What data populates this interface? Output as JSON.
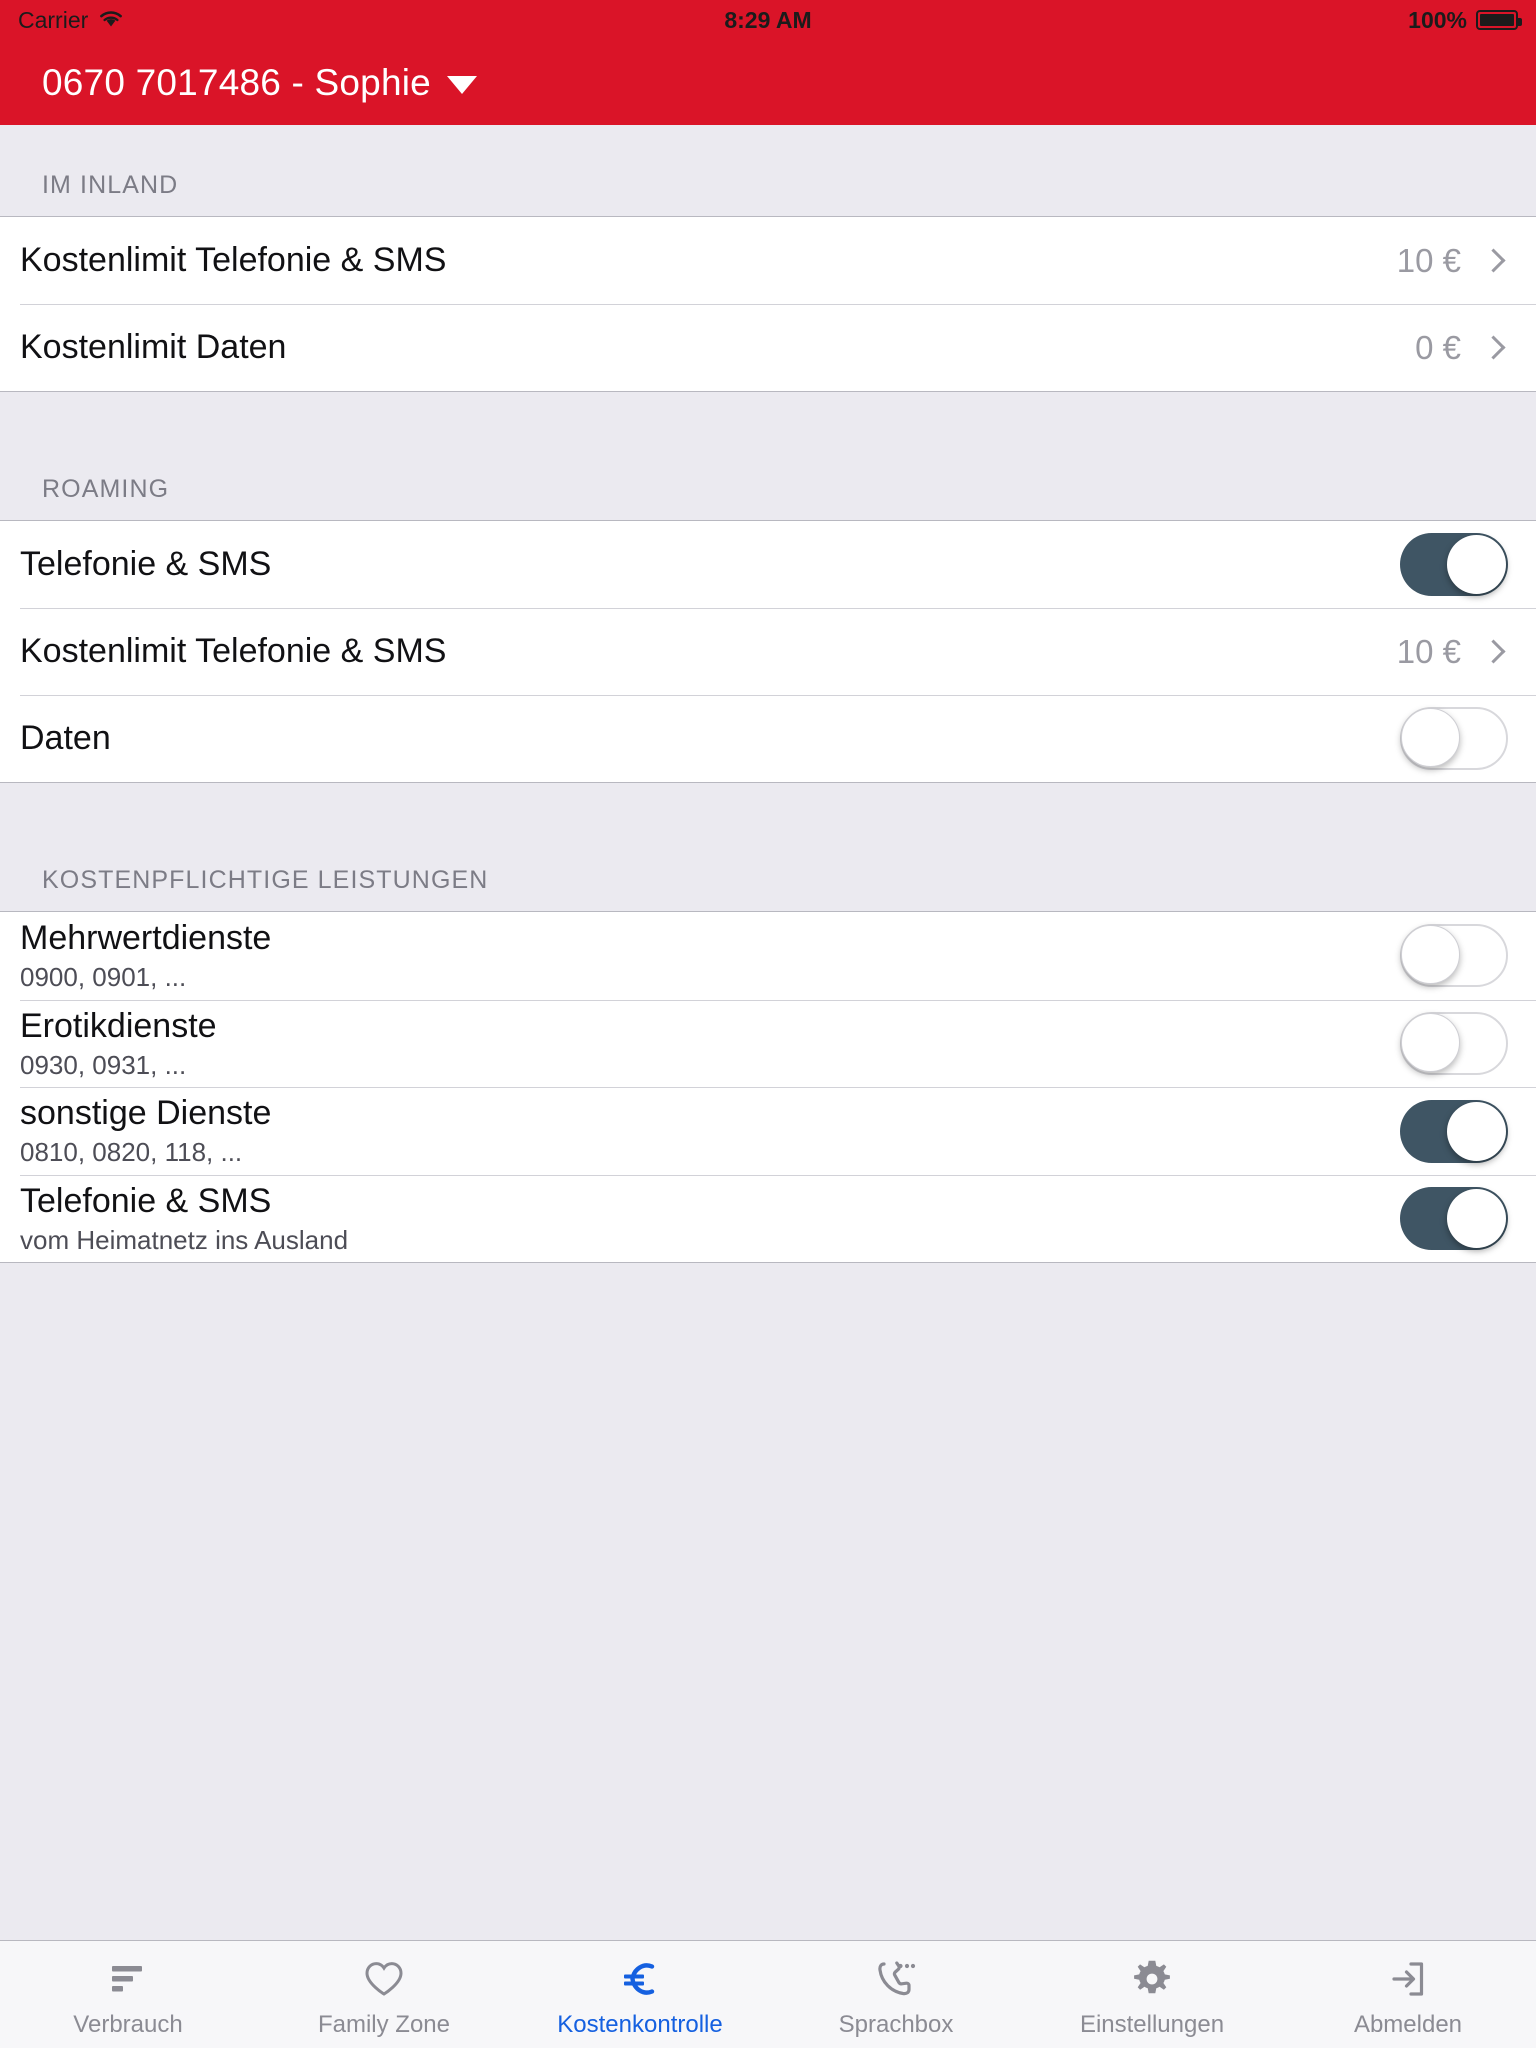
{
  "status_bar": {
    "carrier": "Carrier",
    "wifi_icon": "wifi-icon",
    "time": "8:29 AM",
    "battery_percent": "100%",
    "battery_icon": "battery-full-icon"
  },
  "nav": {
    "title": "0670 7017486 - Sophie",
    "dropdown_icon": "chevron-down-icon"
  },
  "colors": {
    "brand_red": "#DA1428",
    "accent_blue": "#1560E0",
    "toggle_on": "#3F5564",
    "background": "#EBEAF0"
  },
  "sections": [
    {
      "header": "IM INLAND",
      "rows": [
        {
          "title": "Kostenlimit Telefonie & SMS",
          "value": "10 €",
          "accessory": "chevron"
        },
        {
          "title": "Kostenlimit Daten",
          "value": "0 €",
          "accessory": "chevron"
        }
      ]
    },
    {
      "header": "ROAMING",
      "rows": [
        {
          "title": "Telefonie & SMS",
          "accessory": "switch",
          "switch_state": "on"
        },
        {
          "title": "Kostenlimit Telefonie & SMS",
          "value": "10 €",
          "accessory": "chevron"
        },
        {
          "title": "Daten",
          "accessory": "switch",
          "switch_state": "off"
        }
      ]
    },
    {
      "header": "KOSTENPFLICHTIGE LEISTUNGEN",
      "rows": [
        {
          "title": "Mehrwertdienste",
          "subtitle": "0900, 0901, ...",
          "accessory": "switch",
          "switch_state": "off"
        },
        {
          "title": "Erotikdienste",
          "subtitle": "0930, 0931, ...",
          "accessory": "switch",
          "switch_state": "off"
        },
        {
          "title": "sonstige Dienste",
          "subtitle": "0810, 0820, 118, ...",
          "accessory": "switch",
          "switch_state": "on"
        },
        {
          "title": "Telefonie & SMS",
          "subtitle": "vom Heimatnetz ins Ausland",
          "accessory": "switch",
          "switch_state": "on"
        }
      ]
    }
  ],
  "tabbar": {
    "tabs": [
      {
        "label": "Verbrauch",
        "icon": "bar-chart-icon",
        "active": false
      },
      {
        "label": "Family Zone",
        "icon": "heart-icon",
        "active": false
      },
      {
        "label": "Kostenkontrolle",
        "icon": "euro-icon",
        "active": true
      },
      {
        "label": "Sprachbox",
        "icon": "phone-voicemail-icon",
        "active": false
      },
      {
        "label": "Einstellungen",
        "icon": "gear-icon",
        "active": false
      },
      {
        "label": "Abmelden",
        "icon": "logout-icon",
        "active": false
      }
    ]
  }
}
